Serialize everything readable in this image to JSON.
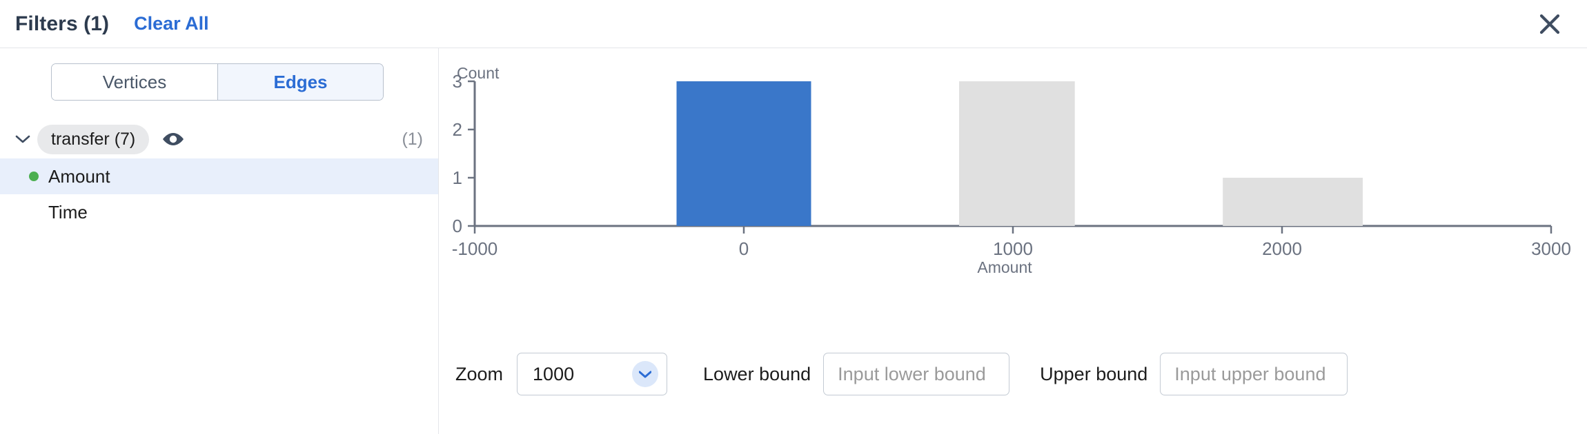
{
  "header": {
    "title": "Filters (1)",
    "clear_all_label": "Clear All",
    "close_icon": "close-icon"
  },
  "sidebar": {
    "segmented": {
      "options": [
        {
          "label": "Vertices",
          "selected": false
        },
        {
          "label": "Edges",
          "selected": true
        }
      ]
    },
    "group": {
      "chevron_icon": "chevron-down-icon",
      "pill_label": "transfer (7)",
      "visibility_icon": "eye-icon",
      "count_label": "(1)"
    },
    "attributes": [
      {
        "label": "Amount",
        "selected": true,
        "has_dot": true
      },
      {
        "label": "Time",
        "selected": false,
        "has_dot": false
      }
    ]
  },
  "controls": {
    "zoom_label": "Zoom",
    "zoom_value": "1000",
    "zoom_caret_icon": "chevron-down-icon",
    "lower_bound_label": "Lower bound",
    "lower_bound_value": "",
    "lower_bound_placeholder": "Input lower bound",
    "upper_bound_label": "Upper bound",
    "upper_bound_value": "",
    "upper_bound_placeholder": "Input upper bound"
  },
  "colors": {
    "accent_blue": "#2b6cd4",
    "bar_selected": "#3a77c9",
    "bar_unselected": "#e0e0e0",
    "axis_gray": "#6b7280",
    "dot_green": "#4caf50",
    "selected_row_bg": "#e8effb"
  },
  "chart_data": {
    "type": "bar",
    "title": "",
    "ylabel": "Count",
    "xlabel": "Amount",
    "xlim": [
      -1000,
      3000
    ],
    "ylim": [
      0,
      3
    ],
    "xticks": [
      -1000,
      0,
      1000,
      2000,
      3000
    ],
    "xtick_labels": [
      "-1000",
      "0",
      "1000",
      "2000",
      "3000"
    ],
    "yticks": [
      0,
      1,
      2,
      3
    ],
    "ytick_labels": [
      "0",
      "1",
      "2",
      "3"
    ],
    "grid": false,
    "legend": "none",
    "bin_width": 500,
    "bars": [
      {
        "x_start": -250,
        "x_end": 250,
        "value": 3,
        "state": "selected"
      },
      {
        "x_start": 800,
        "x_end": 1230,
        "value": 3,
        "state": "unselected"
      },
      {
        "x_start": 1780,
        "x_end": 2300,
        "value": 1,
        "state": "unselected"
      }
    ]
  }
}
